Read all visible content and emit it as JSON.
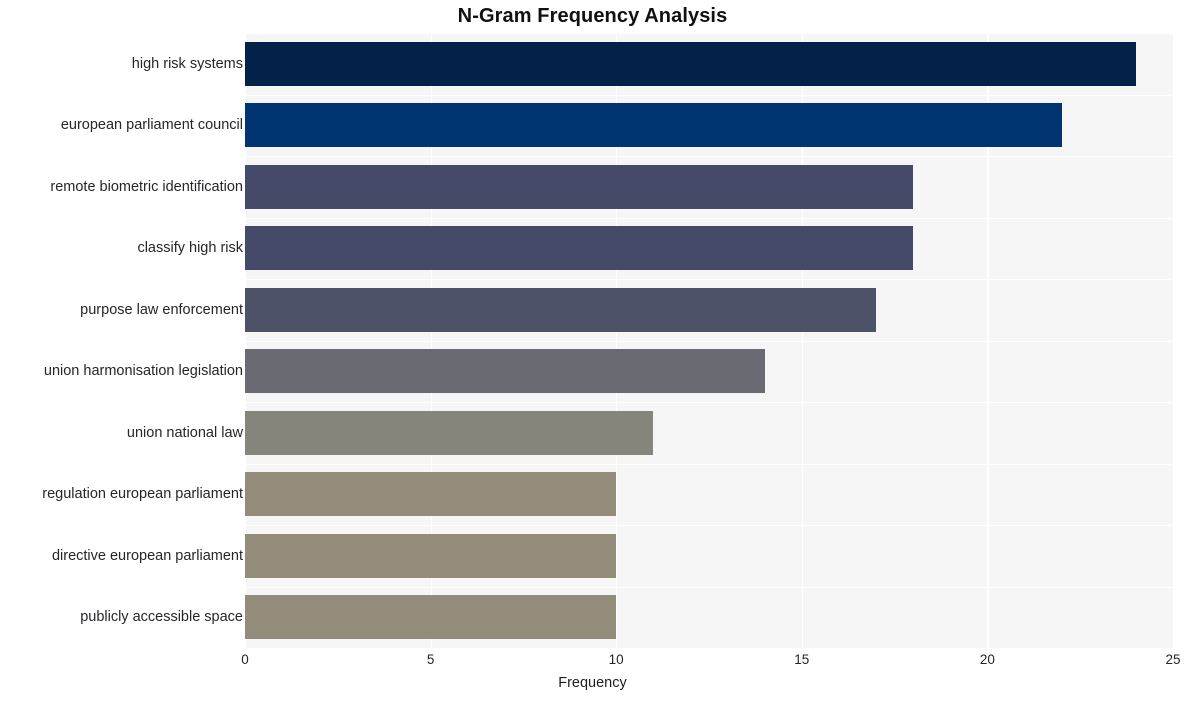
{
  "chart_data": {
    "type": "bar",
    "orientation": "horizontal",
    "title": "N-Gram Frequency Analysis",
    "xlabel": "Frequency",
    "ylabel": "",
    "xlim": [
      0,
      25
    ],
    "xticks": [
      "0",
      "5",
      "10",
      "15",
      "20",
      "25"
    ],
    "grid": true,
    "legend": "none",
    "categories": [
      "high risk systems",
      "european parliament council",
      "remote biometric identification",
      "classify high risk",
      "purpose law enforcement",
      "union harmonisation legislation",
      "union national law",
      "regulation european parliament",
      "directive european parliament",
      "publicly accessible space"
    ],
    "values": [
      24,
      22,
      18,
      18,
      17,
      14,
      11,
      10,
      10,
      10
    ],
    "bar_colors": [
      "#042149",
      "#003571",
      "#444a68",
      "#444a68",
      "#4e5269",
      "#6a6a73",
      "#85857b",
      "#938c7a",
      "#938c7a",
      "#938c7a"
    ],
    "plot_background": "#f6f6f7",
    "figure_background": "#ffffff",
    "gridline_color": "#ffffff"
  }
}
